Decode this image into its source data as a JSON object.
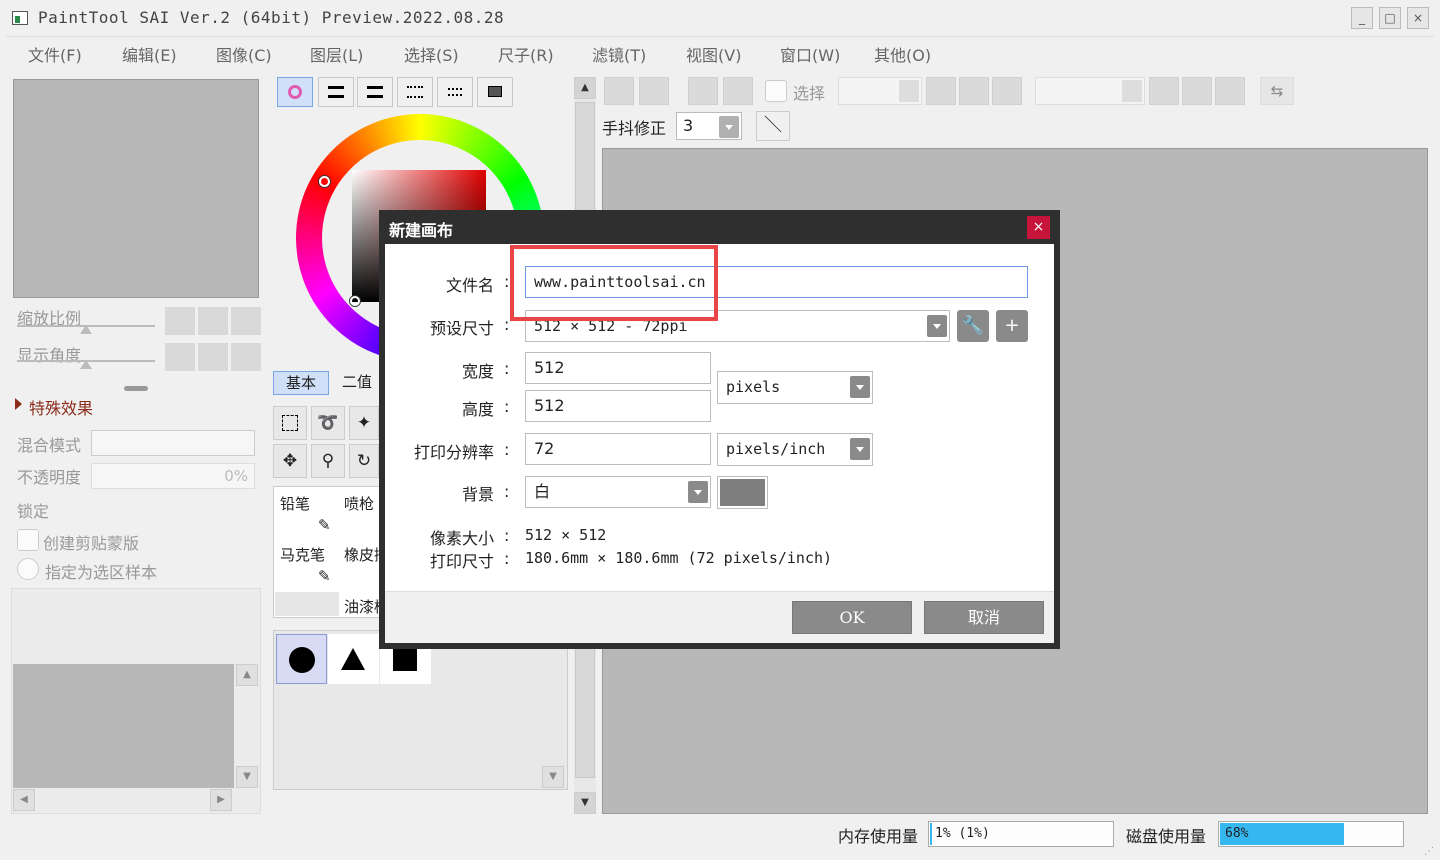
{
  "app": {
    "title": "PaintTool SAI Ver.2 (64bit) Preview.2022.08.28",
    "window_buttons": [
      "_",
      "□",
      "×"
    ]
  },
  "menu": [
    "文件(F)",
    "编辑(E)",
    "图像(C)",
    "图层(L)",
    "选择(S)",
    "尺子(R)",
    "滤镜(T)",
    "视图(V)",
    "窗口(W)",
    "其他(O)"
  ],
  "left_panel": {
    "zoom_label": "缩放比例",
    "angle_label": "显示角度",
    "effects_label": "特殊效果",
    "blend_label": "混合模式",
    "opacity_label": "不透明度",
    "opacity_value": "0%",
    "lock_label": "锁定",
    "clip_label": "创建剪贴蒙版",
    "selection_source_label": "指定为选区样本"
  },
  "tool_panel": {
    "tabs": [
      "基本",
      "二值"
    ],
    "brushes": [
      "铅笔",
      "喷枪",
      "马克笔",
      "橡皮擦",
      "",
      "油漆桶"
    ]
  },
  "canvas_toolbar": {
    "select_label": "选择",
    "stabilizer_label": "手抖修正",
    "stabilizer_value": "3"
  },
  "dialog": {
    "title": "新建画布",
    "close": "×",
    "filename_label": "文件名",
    "filename_value": "www.painttoolsai.cn",
    "preset_label": "预设尺寸",
    "preset_value": "512 × 512 - 72ppi",
    "width_label": "宽度",
    "width_value": "512",
    "height_label": "高度",
    "height_value": "512",
    "size_unit": "pixels",
    "resolution_label": "打印分辨率",
    "resolution_value": "72",
    "resolution_unit": "pixels/inch",
    "background_label": "背景",
    "background_value": "白",
    "pixel_size_label": "像素大小",
    "pixel_size_value": "512 × 512",
    "print_size_label": "打印尺寸",
    "print_size_value": "180.6mm × 180.6mm (72 pixels/inch)",
    "colon": ":",
    "ok": "OK",
    "cancel": "取消"
  },
  "status": {
    "memory_label": "内存使用量",
    "memory_value": "1% (1%)",
    "memory_level": 0.01,
    "disk_label": "磁盘使用量",
    "disk_value": "68%",
    "disk_level": 0.68
  },
  "colors": {
    "accent": "#35b8f0",
    "close_red": "#c7143a",
    "highlight": "#e84646"
  }
}
